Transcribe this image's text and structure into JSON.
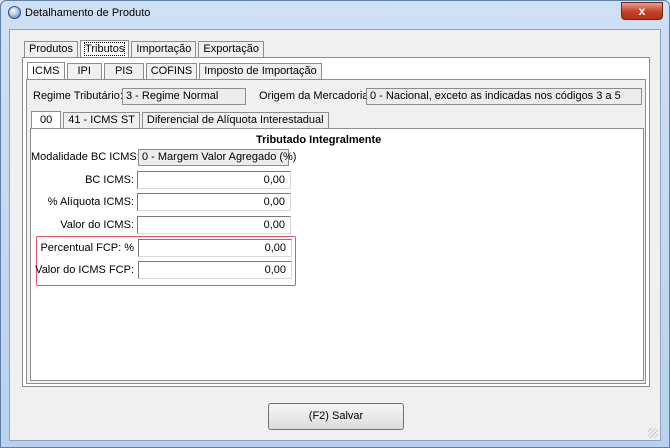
{
  "window": {
    "title": "Detalhamento de Produto",
    "close_glyph": "x"
  },
  "main_tabs": [
    {
      "label": "Produtos",
      "active": false
    },
    {
      "label": "Tributos",
      "active": true
    },
    {
      "label": "Importação",
      "active": false
    },
    {
      "label": "Exportação",
      "active": false
    }
  ],
  "tax_tabs": [
    {
      "label": "ICMS",
      "active": true
    },
    {
      "label": "IPI",
      "active": false
    },
    {
      "label": "PIS",
      "active": false
    },
    {
      "label": "COFINS",
      "active": false
    },
    {
      "label": "Imposto de Importação",
      "active": false
    }
  ],
  "regime": {
    "label": "Regime Tributário:",
    "value": "3 - Regime Normal"
  },
  "origem": {
    "label": "Origem da Mercadoria:",
    "value": "0 - Nacional, exceto as indicadas nos códigos 3 a 5"
  },
  "cst_tabs": [
    {
      "label": "00",
      "active": true
    },
    {
      "label": "41 - ICMS ST",
      "active": false
    },
    {
      "label": "Diferencial de Alíquota Interestadual",
      "active": false
    }
  ],
  "section_title": "Tributado Integralmente",
  "fields": {
    "modalidade": {
      "label": "Modalidade BC ICMS:",
      "value": "0 - Margem Valor Agregado (%)"
    },
    "bc_icms": {
      "label": "BC ICMS:",
      "value": "0,00"
    },
    "aliquota": {
      "label": "% Alíquota ICMS:",
      "value": "0,00"
    },
    "valor_icms": {
      "label": "Valor do ICMS:",
      "value": "0,00"
    },
    "percentual_fcp": {
      "label": "Percentual FCP: %",
      "value": "0,00"
    },
    "valor_fcp": {
      "label": "Valor do ICMS FCP:",
      "value": "0,00"
    }
  },
  "highlight_color": "#e0566e",
  "save_button": {
    "label": "(F2) Salvar"
  }
}
